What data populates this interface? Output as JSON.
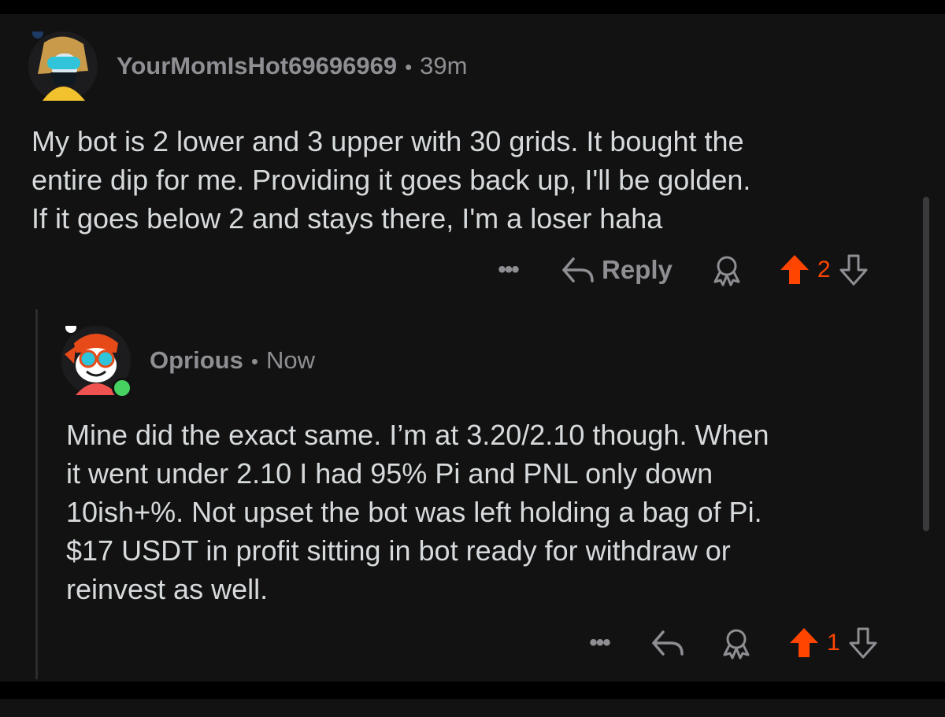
{
  "comments": [
    {
      "author": "YourMomIsHot69696969",
      "separator": "•",
      "time": "39m",
      "body": "My bot is 2 lower and 3 upper with 30 grids. It bought the\nentire dip for me. Providing it goes back up, I'll be golden.\nIf it goes below 2 and stays there, I'm a loser haha",
      "more_label": "•••",
      "reply_label": "Reply",
      "score": "2"
    },
    {
      "author": "Oprious",
      "separator": "•",
      "time": "Now",
      "body": "Mine did the exact same. I’m at 3.20/2.10 though. When\nit went under 2.10 I had 95% Pi and PNL only down\n10ish+%. Not upset the bot was left holding a bag of Pi.\n$17 USDT in profit sitting in bot ready for withdraw or\nreinvest as well.",
      "more_label": "•••",
      "score": "1"
    }
  ],
  "colors": {
    "upvote_active": "#ff4500",
    "online": "#46d160",
    "background": "#121212"
  },
  "icons": [
    "avatar-icon",
    "more-icon",
    "reply-arrow-icon",
    "award-icon",
    "upvote-icon",
    "downvote-icon"
  ]
}
